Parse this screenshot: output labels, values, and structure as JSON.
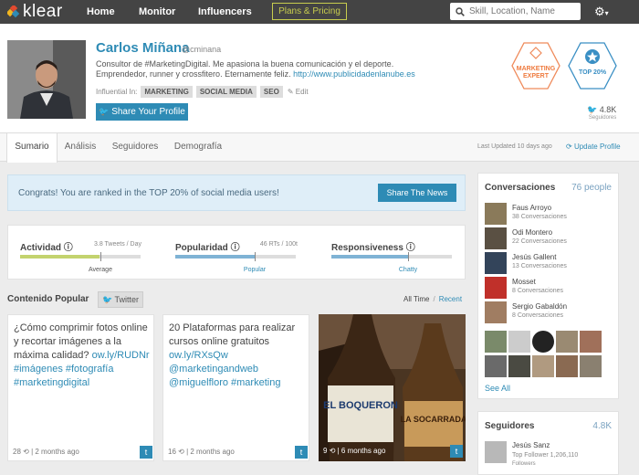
{
  "nav": {
    "logo_text": "klear",
    "items": [
      "Home",
      "Monitor",
      "Influencers"
    ],
    "plans_label": "Plans & Pricing",
    "search_placeholder": "Skill, Location, Name"
  },
  "profile": {
    "name": "Carlos Miñana",
    "handle": "@cminana",
    "bio": "Consultor de #MarketingDigital. Me apasiona la buena comunicación y el deporte. Emprendedor, runner y crossfitero. Eternamente feliz.",
    "bio_link": "http://www.publicidadenlanube.es",
    "influential_label": "Influential In:",
    "tags": [
      "MARKETING",
      "SOCIAL MEDIA",
      "SEO"
    ],
    "edit_label": "Edit",
    "share_label": "Share Your Profile",
    "badge1": "MARKETING EXPERT",
    "badge2": "TOP 20%",
    "followers_count": "4.8K",
    "followers_label": "Seguidores"
  },
  "tabs": [
    "Sumario",
    "Análisis",
    "Seguidores",
    "Demografía"
  ],
  "last_updated": "Last Updated 10 days ago",
  "update_label": "Update Profile",
  "congrats": {
    "text": "Congrats! You are ranked in the TOP 20% of social media users!",
    "button": "Share The News"
  },
  "metrics": [
    {
      "title": "Actividad",
      "value": "3.8 Tweets / Day",
      "label": "Average",
      "fill": 0.66,
      "color": "#c3d36e"
    },
    {
      "title": "Popularidad",
      "value": "46 RTs / 100t",
      "label": "Popular",
      "fill": 0.66,
      "color": "#7fb3d5"
    },
    {
      "title": "Responsiveness",
      "value": "",
      "label": "Chatty",
      "fill": 0.64,
      "color": "#7fb3d5"
    }
  ],
  "content": {
    "title": "Contenido Popular",
    "twitter_tab": "Twitter",
    "all_time": "All Time",
    "recent": "Recent",
    "cards": [
      {
        "text": "¿Cómo comprimir fotos online y recortar imágenes a la máxima calidad?",
        "links": "ow.ly/RUDNr #imágenes #fotografía #marketingdigital",
        "retweets": "28",
        "age": "2 months ago"
      },
      {
        "text": "20 Plataformas para realizar cursos online gratuitos",
        "links": "ow.ly/RXsQw @marketingandweb @miguelfloro #marketing",
        "retweets": "16",
        "age": "2 months ago"
      },
      {
        "retweets": "9",
        "age": "6 months ago",
        "label1": "EL BOQUERON",
        "label2": "LA SOCARRADA"
      }
    ]
  },
  "conversaciones": {
    "title": "Conversaciones",
    "count": "76 people",
    "people": [
      {
        "name": "Faus Arroyo",
        "sub": "38 Conversaciones"
      },
      {
        "name": "Odi Montero",
        "sub": "22 Conversaciones"
      },
      {
        "name": "Jesús Gallent",
        "sub": "13 Conversaciones"
      },
      {
        "name": "Mosset",
        "sub": "8 Conversaciones"
      },
      {
        "name": "Sergio Gabaldón",
        "sub": "8 Conversaciones"
      }
    ],
    "see_all": "See All"
  },
  "seguidores": {
    "title": "Seguidores",
    "count": "4.8K",
    "name": "Jesús Sanz",
    "sub": "Top Follower 1,206,110",
    "sub2": "Followers"
  }
}
